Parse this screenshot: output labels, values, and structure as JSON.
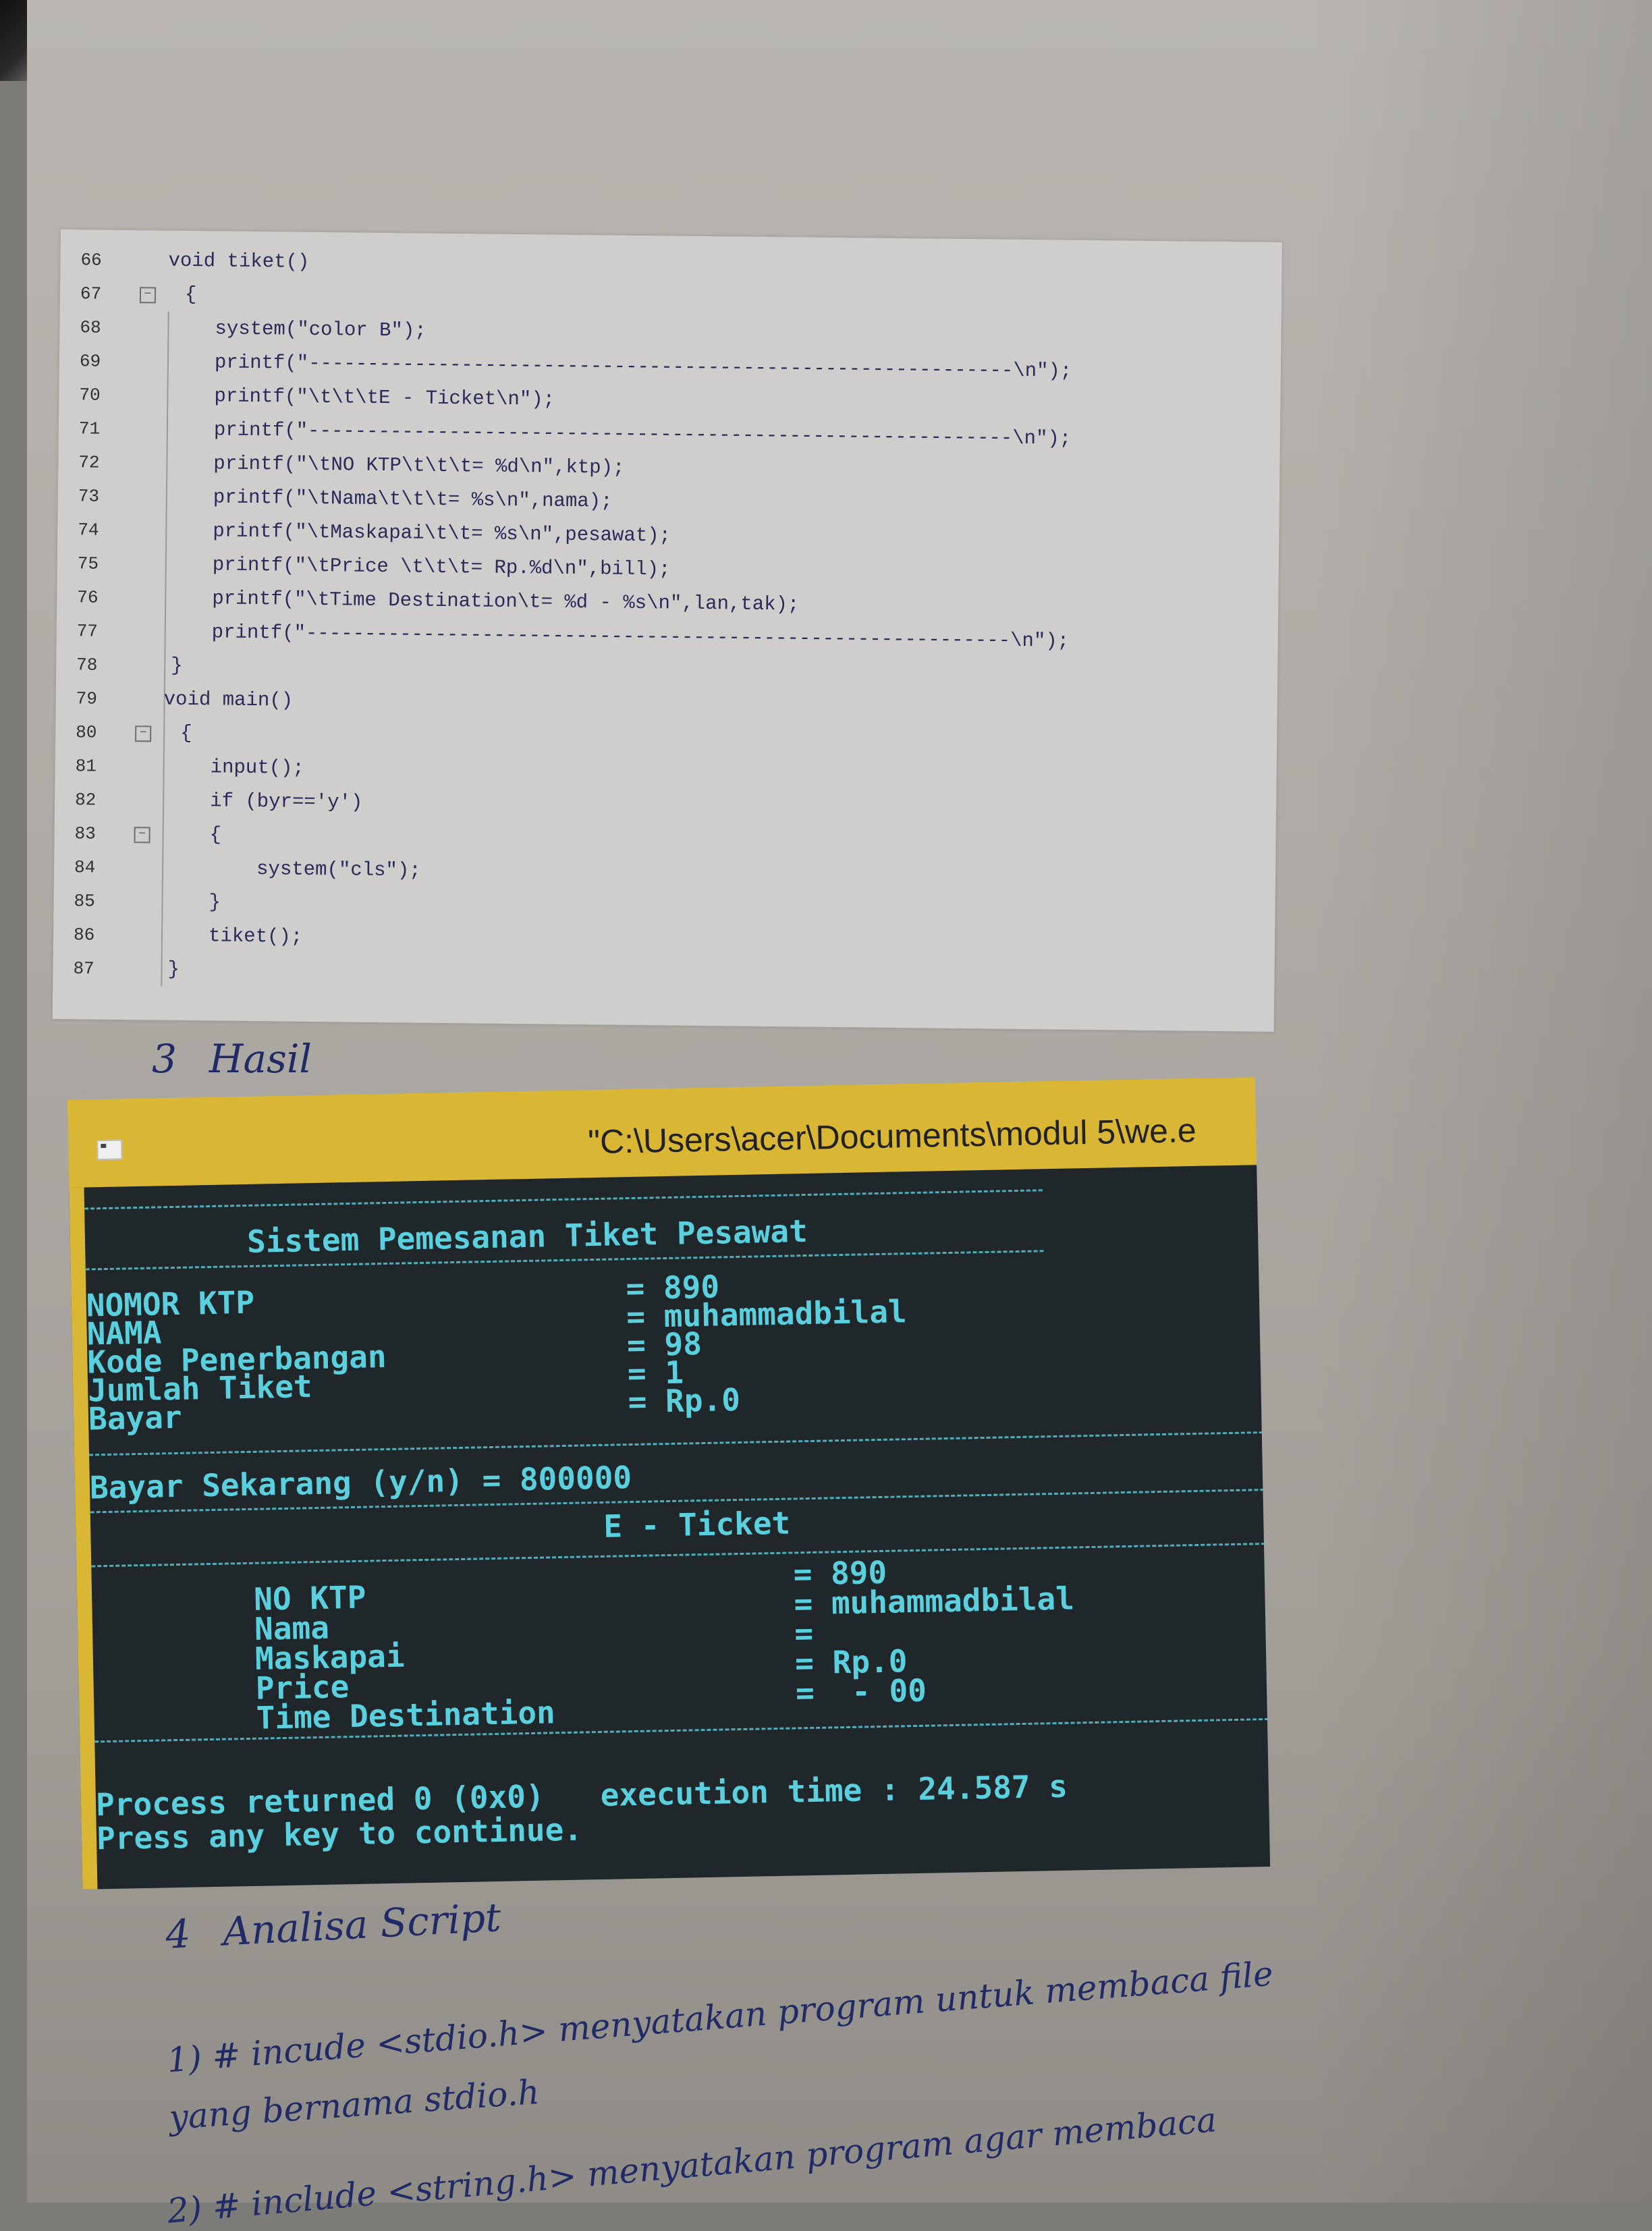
{
  "code": {
    "lines": [
      {
        "no": "66",
        "text": "void tiket()"
      },
      {
        "no": "67",
        "text": "{"
      },
      {
        "no": "68",
        "text": "system(\"color B\");"
      },
      {
        "no": "69",
        "text": "printf(\"------------------------------------------------------------\\n\");"
      },
      {
        "no": "70",
        "text": "printf(\"\\t\\t\\tE - Ticket\\n\");"
      },
      {
        "no": "71",
        "text": "printf(\"------------------------------------------------------------\\n\");"
      },
      {
        "no": "72",
        "text": "printf(\"\\tNO KTP\\t\\t\\t= %d\\n\",ktp);"
      },
      {
        "no": "73",
        "text": "printf(\"\\tNama\\t\\t\\t= %s\\n\",nama);"
      },
      {
        "no": "74",
        "text": "printf(\"\\tMaskapai\\t\\t= %s\\n\",pesawat);"
      },
      {
        "no": "75",
        "text": "printf(\"\\tPrice \\t\\t\\t= Rp.%d\\n\",bill);"
      },
      {
        "no": "76",
        "text": "printf(\"\\tTime Destination\\t= %d - %s\\n\",lan,tak);"
      },
      {
        "no": "77",
        "text": "printf(\"------------------------------------------------------------\\n\");"
      },
      {
        "no": "78",
        "text": "}"
      },
      {
        "no": "79",
        "text": "void main()"
      },
      {
        "no": "80",
        "text": "{"
      },
      {
        "no": "81",
        "text": "input();"
      },
      {
        "no": "82",
        "text": "if (byr=='y')"
      },
      {
        "no": "83",
        "text": "{"
      },
      {
        "no": "84",
        "text": "system(\"cls\");"
      },
      {
        "no": "85",
        "text": "}"
      },
      {
        "no": "86",
        "text": "tiket();"
      },
      {
        "no": "87",
        "text": "}"
      }
    ]
  },
  "section_hasil": {
    "number": "3",
    "title": "Hasil"
  },
  "console": {
    "title": "\"C:\\Users\\acer\\Documents\\modul 5\\we.e",
    "header": "Sistem Pemesanan Tiket Pesawat",
    "fields": [
      {
        "label": "NOMOR KTP",
        "value": "= 890"
      },
      {
        "label": "NAMA",
        "value": "= muhammadbilal"
      },
      {
        "label": "Kode Penerbangan",
        "value": "= 98"
      },
      {
        "label": "Jumlah Tiket",
        "value": "= 1"
      },
      {
        "label": "Bayar",
        "value": "= Rp.0"
      }
    ],
    "pay_prompt": "Bayar Sekarang (y/n) = 800000",
    "ticket_header": "E - Ticket",
    "ticket_labels": [
      "NO KTP",
      "Nama",
      "Maskapai",
      "Price",
      "Time Destination"
    ],
    "ticket_values": [
      "= 890",
      "= muhammadbilal",
      "=",
      "= Rp.0",
      "=  - 00"
    ],
    "process_line": "Process returned 0 (0x0)   execution time : 24.587 s",
    "continue_line": "Press any key to continue."
  },
  "section_analisa": {
    "number": "4",
    "title": "Analisa Script"
  },
  "notes": [
    "1) # incude <stdio.h> menyatakan program untuk membaca file",
    "yang bernama stdio.h",
    "2) # include <string.h> menyatakan program agar membaca"
  ]
}
